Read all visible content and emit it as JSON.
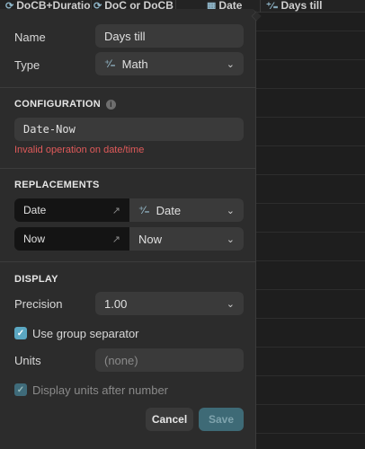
{
  "background": {
    "columns": [
      {
        "label": "DoCB+Duration",
        "icon": "formula-icon"
      },
      {
        "label": "DoC or DoCB",
        "icon": "formula-icon"
      },
      {
        "label": "Date",
        "icon": "calendar-icon"
      },
      {
        "label": "Days till",
        "icon": "math-icon"
      }
    ]
  },
  "dialog": {
    "name_label": "Name",
    "name_value": "Days till",
    "type_label": "Type",
    "type_value": "Math",
    "configuration_title": "CONFIGURATION",
    "formula_value": "Date-Now",
    "error_text": "Invalid operation on date/time",
    "replacements_title": "REPLACEMENTS",
    "replacements": [
      {
        "name": "Date",
        "value": "Date",
        "value_icon": "math-icon"
      },
      {
        "name": "Now",
        "value": "Now",
        "value_icon": ""
      }
    ],
    "display_title": "DISPLAY",
    "precision_label": "Precision",
    "precision_value": "1.00",
    "group_separator_label": "Use group separator",
    "group_separator_checked": true,
    "units_label": "Units",
    "units_placeholder": "(none)",
    "units_after_label": "Display units after number",
    "units_after_checked": true,
    "cancel_label": "Cancel",
    "save_label": "Save"
  },
  "colors": {
    "accent": "#5ba7c2",
    "error": "#e05a5a",
    "dialog_bg": "#2c2c2c"
  }
}
